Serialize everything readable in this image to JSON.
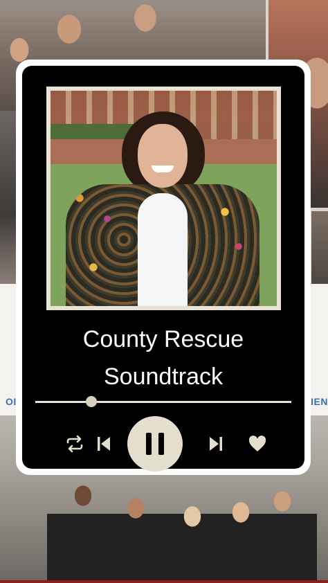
{
  "player": {
    "track_title": "County Rescue Soundtrack",
    "progress": 0.22
  },
  "background": {
    "band_left_text": "OI",
    "band_right_text": "RIEN"
  },
  "icons": {
    "repeat": "repeat-icon",
    "previous": "skip-previous-icon",
    "pause": "pause-icon",
    "next": "skip-next-icon",
    "like": "heart-icon"
  },
  "colors": {
    "card_background": "#000000",
    "card_border": "#ffffff",
    "accent": "#e4dfcd",
    "band_text": "#3d6fb0"
  }
}
